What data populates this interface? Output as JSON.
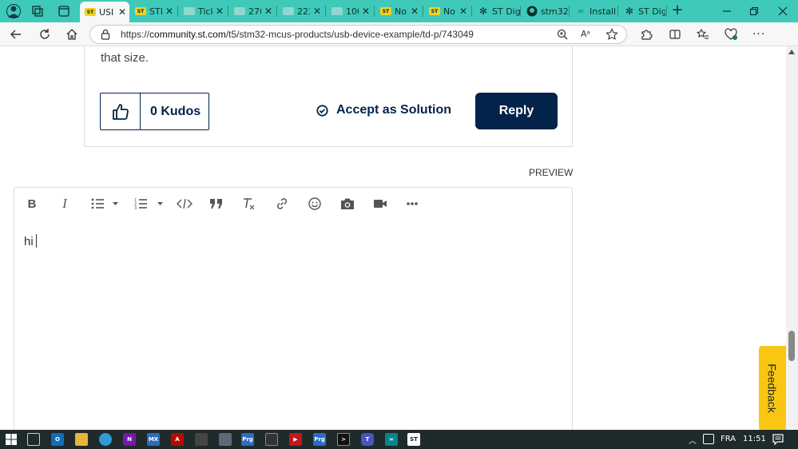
{
  "browser": {
    "tabs": [
      {
        "label": "USI",
        "icon": "st-logo-icon",
        "active": true
      },
      {
        "label": "STM",
        "icon": "st-logo-icon"
      },
      {
        "label": "Tick",
        "icon": "folder-icon"
      },
      {
        "label": "270",
        "icon": "folder-icon"
      },
      {
        "label": "223",
        "icon": "folder-icon"
      },
      {
        "label": "100",
        "icon": "folder-icon"
      },
      {
        "label": "No",
        "icon": "st-logo-icon"
      },
      {
        "label": "No",
        "icon": "st-logo-icon"
      },
      {
        "label": "ST Digit",
        "icon": "snowflake-icon"
      },
      {
        "label": "stm32d",
        "icon": "github-icon"
      },
      {
        "label": "Installin",
        "icon": "arduino-icon"
      },
      {
        "label": "ST Digit",
        "icon": "snowflake-icon"
      }
    ],
    "new_tab": "+",
    "url": "https://community.st.com/t5/stm32-mcus-products/usb-device-example/td-p/743049",
    "read_aloud": "Aᵃ"
  },
  "post": {
    "snippet": "that size.",
    "kudos_label": "0 Kudos",
    "accept_label": "Accept as Solution",
    "reply_label": "Reply"
  },
  "editor": {
    "preview_label": "PREVIEW",
    "text": "hi",
    "toolbar": [
      "bold",
      "italic",
      "bulleted-list",
      "numbered-list",
      "code",
      "quote",
      "clear-format",
      "link",
      "emoji",
      "photo",
      "video",
      "more"
    ]
  },
  "feedback_label": "Feedback",
  "taskbar": {
    "language": "FRA",
    "time": "11:51"
  },
  "colors": {
    "brand_navy": "#03234b",
    "tabbar": "#3fc9b8",
    "feedback": "#f9c713"
  }
}
